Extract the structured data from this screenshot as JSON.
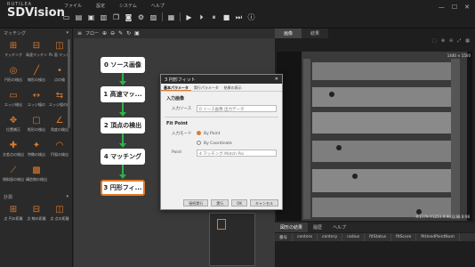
{
  "app": {
    "brand_sub": "RUTILEA",
    "brand_name": "SDVision"
  },
  "menus": [
    "ファイル",
    "設定",
    "システム",
    "ヘルプ"
  ],
  "toolbar_icons": [
    "new-icon",
    "open-folder-icon",
    "save-icon",
    "save-as-icon",
    "copy-icon",
    "camera-icon",
    "settings-icon",
    "image-icon",
    "grid-icon",
    "run-icon",
    "run-once-icon",
    "pause-icon",
    "stop-icon",
    "next-icon",
    "info-icon"
  ],
  "window_controls": [
    "—",
    "☐",
    "✕"
  ],
  "palette": {
    "title": "マッチング",
    "items": [
      {
        "label": "マッチング",
        "icon": "matching-icon"
      },
      {
        "label": "高速マッチング",
        "icon": "fast-matching-icon"
      },
      {
        "label": "PL 面 マッチング",
        "icon": "plane-matching-icon"
      },
      {
        "label": "円形の検出",
        "icon": "circle-detect-icon"
      },
      {
        "label": "線形の検出",
        "icon": "line-detect-icon"
      },
      {
        "label": "点の検",
        "icon": "point-detect-icon"
      },
      {
        "label": "エッジ検出",
        "icon": "edge-detect-icon"
      },
      {
        "label": "エッジ幅の",
        "icon": "edge-width-icon"
      },
      {
        "label": "エッジ組の検出",
        "icon": "edge-pair-icon"
      },
      {
        "label": "位置補正",
        "icon": "position-correct-icon"
      },
      {
        "label": "矩形の検出",
        "icon": "rect-detect-icon"
      },
      {
        "label": "角度の検出",
        "icon": "angle-detect-icon"
      },
      {
        "label": "交差点の検出",
        "icon": "intersection-icon"
      },
      {
        "label": "特徴の検出",
        "icon": "feature-detect-icon"
      },
      {
        "label": "円弧の検出",
        "icon": "arc-detect-icon"
      },
      {
        "label": "傾斜面の検出",
        "icon": "slope-detect-icon"
      },
      {
        "label": "構造物の検出",
        "icon": "structure-detect-icon"
      }
    ],
    "section2": "計測",
    "section2_items": [
      {
        "label": "点 円の距離",
        "icon": "point-circle-distance-icon"
      },
      {
        "label": "点 線の距離",
        "icon": "point-line-distance-icon"
      },
      {
        "label": "点 点の距離",
        "icon": "point-point-distance-icon"
      }
    ]
  },
  "flow": {
    "title": "フロー",
    "nodes": [
      {
        "label": "0 ソース画像"
      },
      {
        "label": "1 高速マッ..."
      },
      {
        "label": "2 頂点の検出"
      },
      {
        "label": "4 マッチング"
      },
      {
        "label": "3 円形フィ..."
      }
    ]
  },
  "right": {
    "tabs": [
      "画像",
      "結果"
    ],
    "image_size": "1440 × 1500",
    "coords": "X:1779 Y:1251 R:98 G:98 B:98",
    "result_tabs": [
      "図形の結果",
      "履歴",
      "ヘルプ"
    ],
    "columns": [
      "番号",
      "centerx",
      "centery",
      "radius",
      "fitStatus",
      "fitScore",
      "fitUsedPointNum"
    ]
  },
  "dialog": {
    "title": "3 円形フィット",
    "tabs": [
      "基本パラメータ",
      "実行パラメータ",
      "結果の表示"
    ],
    "section_input": "入力画像",
    "input_label": "入力ソース",
    "input_value": "0 ソース画像.出力データ",
    "section_fit": "Fit Point",
    "mode_label": "入力モード",
    "mode_options": [
      "By Point",
      "By Coordinate"
    ],
    "point_label": "Point",
    "point_value": "4 マッチング.Match Poi",
    "buttons": [
      "接続実行",
      "実行",
      "OK",
      "キャンセル"
    ]
  }
}
